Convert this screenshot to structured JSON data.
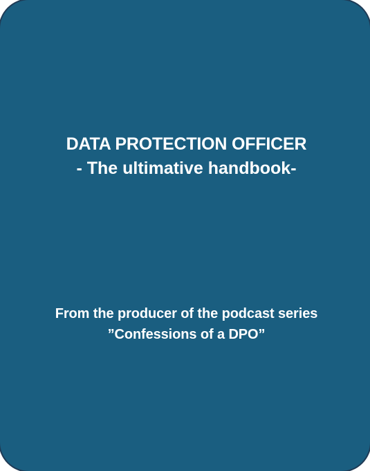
{
  "cover": {
    "background_color": "#1a5e80",
    "border_color": "#1f3a55",
    "text_color": "#ffffff",
    "title": "DATA PROTECTION OFFICER",
    "subtitle": "-   The ultimative handbook-",
    "byline_line1": "From the producer of the podcast series",
    "byline_line2": "”Confessions of a DPO”"
  }
}
